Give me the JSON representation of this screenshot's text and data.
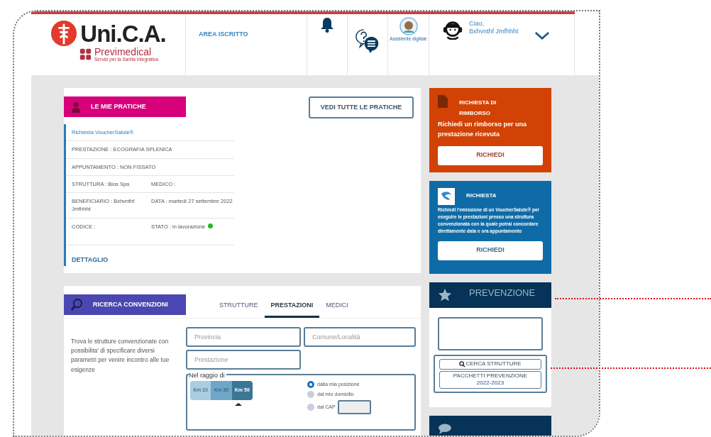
{
  "header": {
    "brand": "Uni.C.A.",
    "sub_brand": "Previmedical",
    "tagline": "Servizi per la Sanità Integrativa",
    "area_label": "AREA ISCRITTO",
    "assistant_label": "Assistente digitale",
    "greeting": "Ciao,",
    "user_name": "Bxhvnthf Jmfhhht"
  },
  "pratiche": {
    "title": "LE MIE PRATICHE",
    "button": "VEDI TUTTE LE PRATICHE",
    "link": "Richiesta VoucherSalute®",
    "rows": [
      [
        {
          "label": "PRESTAZIONE :",
          "value": "ECOGRAFIA SPLENICA"
        }
      ],
      [
        {
          "label": "APPUNTAMENTO :",
          "value": "NON FISSATO"
        }
      ],
      [
        {
          "label": "STRUTTURA :",
          "value": "Bios Spa"
        },
        {
          "label": "MEDICO :"
        }
      ],
      [
        {
          "label": "BENEFICIARIO :",
          "value": "Bxhvnthf Jmfhhht"
        },
        {
          "label": "DATA :",
          "value": "martedì 27 settembre 2022"
        }
      ],
      [
        {
          "label": "CODICE :"
        },
        {
          "label": "STATO :",
          "value": "in lavorazione",
          "color": "#22bb22"
        }
      ]
    ],
    "detail": "DETTAGLIO"
  },
  "ricerca": {
    "title": "RICERCA CONVENZIONI",
    "tabs": [
      {
        "label": "STRUTTURE",
        "selected": false
      },
      {
        "label": "PRESTAZIONI",
        "selected": true
      },
      {
        "label": "MEDICI",
        "selected": false
      }
    ],
    "description": "Trova le strutture convenzionate con possibilita' di specificare diversi parametri per venire incontro alle tue esigenze",
    "fields": [
      {
        "placeholder": "Provincia"
      },
      {
        "placeholder": "Comune/Località"
      },
      {
        "placeholder": "Prestazione"
      }
    ],
    "radius_legend": "Nel raggio di",
    "km_options": [
      {
        "label": "Km 10",
        "selected": false
      },
      {
        "label": "Km 30",
        "selected": false
      },
      {
        "label": "Km 50",
        "selected": true
      }
    ],
    "origins": [
      {
        "label": "dalla mia posizione",
        "checked": true
      },
      {
        "label": "dal mio domicilio",
        "checked": false
      },
      {
        "label": "dal CAP",
        "checked": false
      }
    ]
  },
  "rimborso": {
    "title": "RICHIESTA DI RIMBORSO",
    "text": "Richiedi un rimborso per una prestazione ricevuta",
    "button": "RICHIEDI"
  },
  "voucher": {
    "title": "RICHIESTA",
    "text": "Richiedi l'emissione di un VoucherSalute® per eseguire le prestazioni presso una struttura convenzionata con la quale potrai concordare direttamente data e ora appuntamento",
    "button": "RICHIEDI"
  },
  "prevenzione": {
    "title": "PREVENZIONE",
    "buttons": [
      {
        "lines": [
          "CERCA STRUTTURE"
        ]
      },
      {
        "lines": [
          "PACCHETTI PREVENZIONE",
          "2022-2023"
        ]
      }
    ]
  }
}
